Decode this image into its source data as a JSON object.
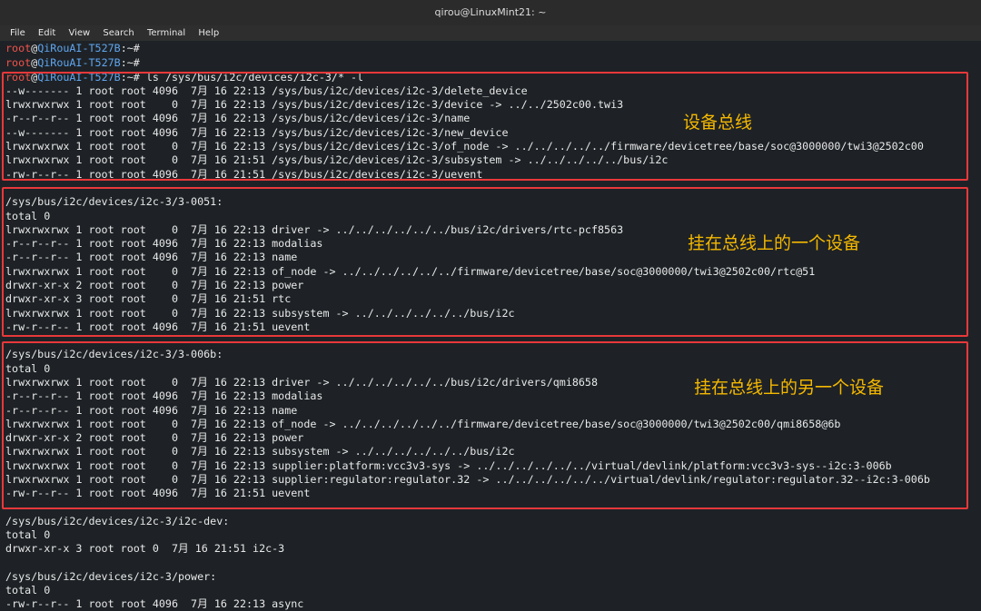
{
  "window": {
    "title": "qirou@LinuxMint21: ~"
  },
  "menu": [
    "File",
    "Edit",
    "View",
    "Search",
    "Terminal",
    "Help"
  ],
  "prompt": {
    "user": "root",
    "at": "@",
    "host": "QiRouAI-T527B",
    "suffix": ":~#"
  },
  "command": " ls /sys/bus/i2c/devices/i2c-3/* -l",
  "annotations": {
    "bus": "设备总线",
    "device1": "挂在总线上的一个设备",
    "device2": "挂在总线上的另一个设备"
  },
  "lines": {
    "l3": "--w------- 1 root root 4096  7月 16 22:13 /sys/bus/i2c/devices/i2c-3/delete_device",
    "l4": "lrwxrwxrwx 1 root root    0  7月 16 22:13 /sys/bus/i2c/devices/i2c-3/device -> ../../2502c00.twi3",
    "l5": "-r--r--r-- 1 root root 4096  7月 16 22:13 /sys/bus/i2c/devices/i2c-3/name",
    "l6": "--w------- 1 root root 4096  7月 16 22:13 /sys/bus/i2c/devices/i2c-3/new_device",
    "l7": "lrwxrwxrwx 1 root root    0  7月 16 22:13 /sys/bus/i2c/devices/i2c-3/of_node -> ../../../../../firmware/devicetree/base/soc@3000000/twi3@2502c00",
    "l8": "lrwxrwxrwx 1 root root    0  7月 16 21:51 /sys/bus/i2c/devices/i2c-3/subsystem -> ../../../../../bus/i2c",
    "l9": "-rw-r--r-- 1 root root 4096  7月 16 21:51 /sys/bus/i2c/devices/i2c-3/uevent",
    "l11": "/sys/bus/i2c/devices/i2c-3/3-0051:",
    "l12": "total 0",
    "l13": "lrwxrwxrwx 1 root root    0  7月 16 22:13 driver -> ../../../../../../bus/i2c/drivers/rtc-pcf8563",
    "l14": "-r--r--r-- 1 root root 4096  7月 16 22:13 modalias",
    "l15": "-r--r--r-- 1 root root 4096  7月 16 22:13 name",
    "l16": "lrwxrwxrwx 1 root root    0  7月 16 22:13 of_node -> ../../../../../../firmware/devicetree/base/soc@3000000/twi3@2502c00/rtc@51",
    "l17": "drwxr-xr-x 2 root root    0  7月 16 22:13 power",
    "l18": "drwxr-xr-x 3 root root    0  7月 16 21:51 rtc",
    "l19": "lrwxrwxrwx 1 root root    0  7月 16 22:13 subsystem -> ../../../../../../bus/i2c",
    "l20": "-rw-r--r-- 1 root root 4096  7月 16 21:51 uevent",
    "l22": "/sys/bus/i2c/devices/i2c-3/3-006b:",
    "l23": "total 0",
    "l24": "lrwxrwxrwx 1 root root    0  7月 16 22:13 driver -> ../../../../../../bus/i2c/drivers/qmi8658",
    "l25": "-r--r--r-- 1 root root 4096  7月 16 22:13 modalias",
    "l26": "-r--r--r-- 1 root root 4096  7月 16 22:13 name",
    "l27": "lrwxrwxrwx 1 root root    0  7月 16 22:13 of_node -> ../../../../../../firmware/devicetree/base/soc@3000000/twi3@2502c00/qmi8658@6b",
    "l28": "drwxr-xr-x 2 root root    0  7月 16 22:13 power",
    "l29": "lrwxrwxrwx 1 root root    0  7月 16 22:13 subsystem -> ../../../../../../bus/i2c",
    "l30": "lrwxrwxrwx 1 root root    0  7月 16 22:13 supplier:platform:vcc3v3-sys -> ../../../../../../virtual/devlink/platform:vcc3v3-sys--i2c:3-006b",
    "l31": "lrwxrwxrwx 1 root root    0  7月 16 22:13 supplier:regulator:regulator.32 -> ../../../../../../virtual/devlink/regulator:regulator.32--i2c:3-006b",
    "l32": "-rw-r--r-- 1 root root 4096  7月 16 21:51 uevent",
    "l34": "/sys/bus/i2c/devices/i2c-3/i2c-dev:",
    "l35": "total 0",
    "l36": "drwxr-xr-x 3 root root 0  7月 16 21:51 i2c-3",
    "l38": "/sys/bus/i2c/devices/i2c-3/power:",
    "l39": "total 0",
    "l40": "-rw-r--r-- 1 root root 4096  7月 16 22:13 async"
  }
}
